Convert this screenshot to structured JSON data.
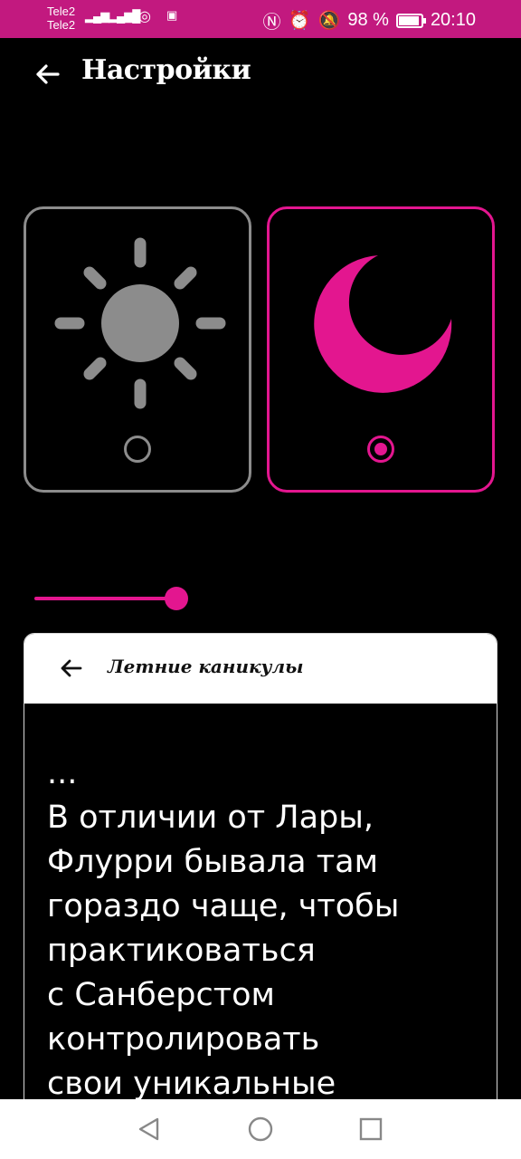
{
  "status_bar": {
    "carrier1": "Tele2",
    "carrier2": "Tele2",
    "battery": "98 %",
    "time": "20:10",
    "icons": [
      "nfc-icon",
      "alarm-icon",
      "mute-icon",
      "battery-icon"
    ]
  },
  "header": {
    "title": "Настройки",
    "back_icon": "arrow-left-icon"
  },
  "themes": {
    "light_icon": "sun-icon",
    "dark_icon": "moon-icon",
    "selected": "dark"
  },
  "slider": {
    "value_fraction": 0.5
  },
  "preview": {
    "title": "Летние каникулы",
    "text": "...\nВ отличии от Лары,\nФлурри бывала там\nгораздо чаще, чтобы\nпрактиковаться\nс Санберстом\nконтролировать\nсвои уникальные"
  },
  "colors": {
    "accent": "#e3168f",
    "status_bar": "#c2197f",
    "inactive": "#8c8c8c"
  },
  "nav": {
    "icons": [
      "back-triangle-icon",
      "home-circle-icon",
      "recents-square-icon"
    ]
  }
}
